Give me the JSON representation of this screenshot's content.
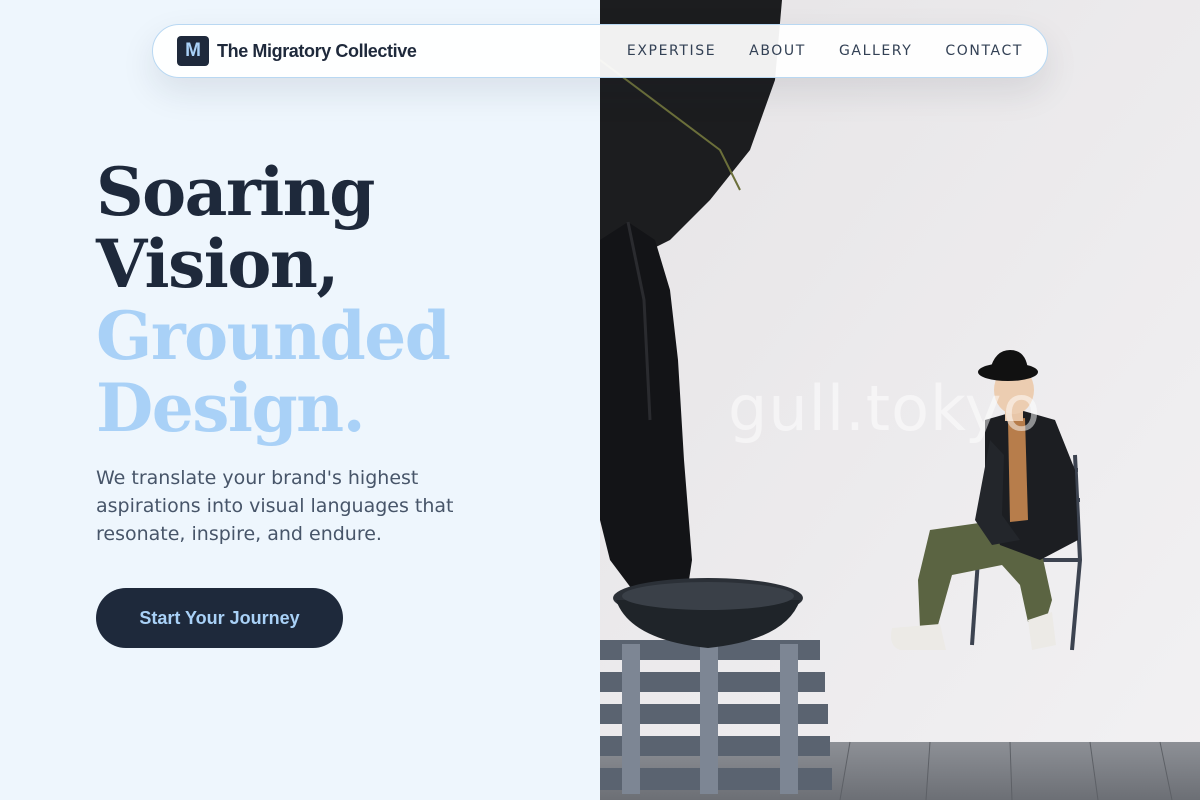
{
  "navbar": {
    "brand_mark": "M",
    "brand_name": "The Migratory Collective",
    "links": [
      "EXPERTISE",
      "ABOUT",
      "GALLERY",
      "CONTACT"
    ]
  },
  "hero": {
    "headline_dark": [
      "Soaring",
      "Vision,"
    ],
    "headline_light": [
      "Grounded",
      "Design."
    ],
    "tagline": "We translate your brand's highest aspirations into visual languages that resonate, inspire, and endure.",
    "cta_label": "Start Your Journey"
  },
  "photo": {
    "watermark": "gull.tokyo"
  },
  "colors": {
    "navy": "#1e293b",
    "accent_light_blue": "#a9d1f7",
    "background": "#eef6fd",
    "body_text": "#475569"
  }
}
